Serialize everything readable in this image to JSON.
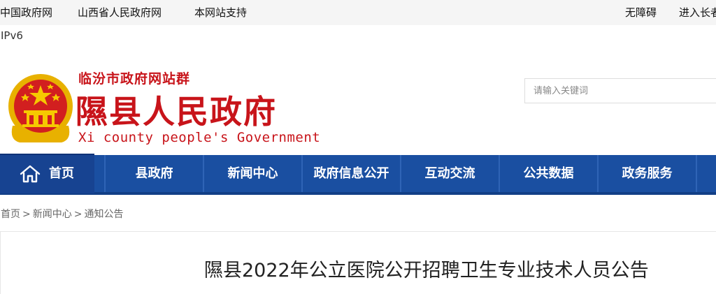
{
  "topbar": {
    "links_left": [
      "中国政府网",
      "山西省人民政府网",
      "本网站支持"
    ],
    "accessibility": "无障碍",
    "elder_mode": "进入长者"
  },
  "ipv6": "IPv6",
  "header": {
    "site_group": "临汾市政府网站群",
    "title": "隰县人民政府",
    "subtitle": "Xi county people's Government",
    "emblem_icon": "national-emblem-icon"
  },
  "search": {
    "placeholder": "请输入关键词"
  },
  "nav": {
    "home": "首页",
    "items": [
      "县政府",
      "新闻中心",
      "政府信息公开",
      "互动交流",
      "公共数据",
      "政务服务"
    ]
  },
  "breadcrumb": [
    "首页",
    "新闻中心",
    "通知公告"
  ],
  "breadcrumb_sep": ">",
  "article": {
    "title": "隰县2022年公立医院公开招聘卫生专业技术人员公告"
  },
  "colors": {
    "brand_red": "#c8141a",
    "nav_blue": "#1a4fa1",
    "nav_home_blue": "#174391"
  }
}
